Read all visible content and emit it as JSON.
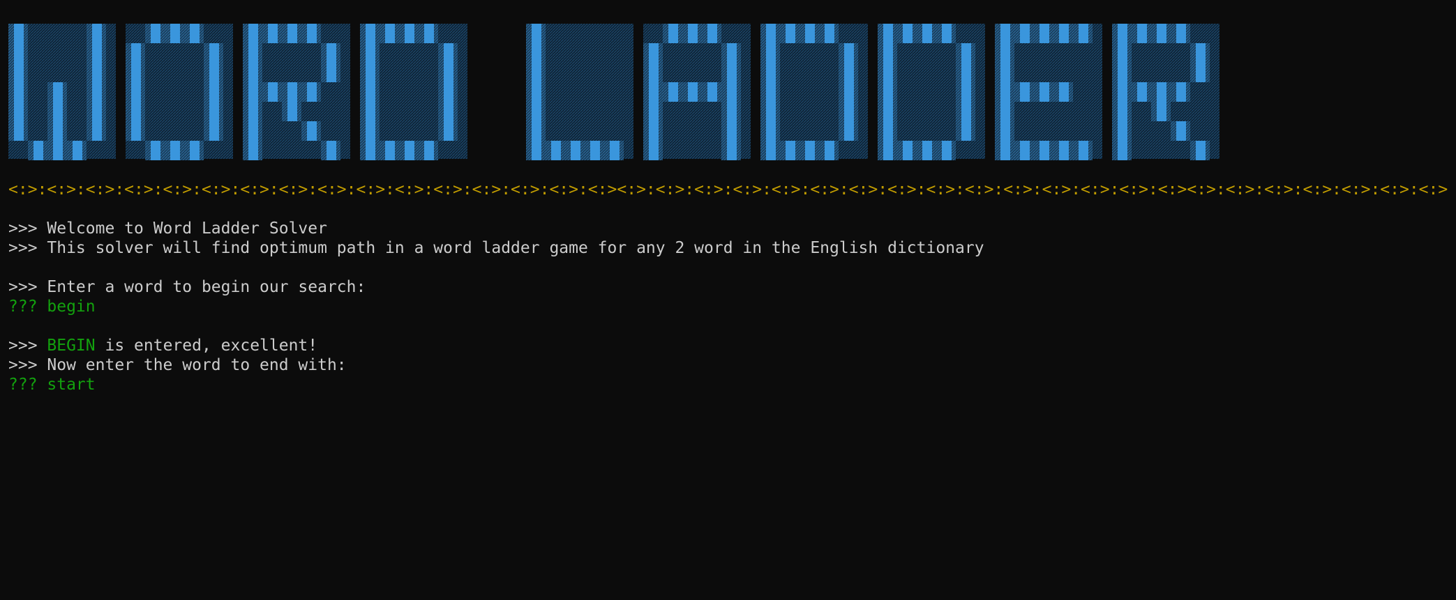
{
  "banner": {
    "text": "WORD LADDER",
    "colors": {
      "bright": "#3a96dd",
      "mid": "#2b6fa3",
      "dark": "#1b3e5c",
      "shade": "#142c42"
    }
  },
  "divider": "<:>:<:>:<:>:<:>:<:>:<:>:<:>:<:>:<:>:<:>:<:>:<:>:<:>:<:>:<:>:<:><:>:<:>:<:>:<:>:<:>:<:>:<:>:<:>:<:>:<:>:<:>:<:>:<:>:<:>:<:><:>:<:>:<:>:<:>:<:>:<:>:<:>",
  "lines": {
    "welcome_prompt": ">>> ",
    "welcome": "Welcome to Word Ladder Solver",
    "desc_prompt": ">>> ",
    "desc": "This solver will find optimum path in a word ladder game for any 2 word in the English dictionary",
    "enter_prompt": ">>> ",
    "enter": "Enter a word to begin our search:",
    "input1_prompt": "??? ",
    "input1": "begin",
    "confirm_prompt": ">>> ",
    "confirm_word": "BEGIN",
    "confirm_rest": " is entered, excellent!",
    "end_prompt": ">>> ",
    "end": "Now enter the word to end with:",
    "input2_prompt": "??? ",
    "input2": "start"
  },
  "colors": {
    "background": "#0c0c0c",
    "foreground": "#cccccc",
    "green": "#13a10e",
    "divider": "#c19c00"
  }
}
